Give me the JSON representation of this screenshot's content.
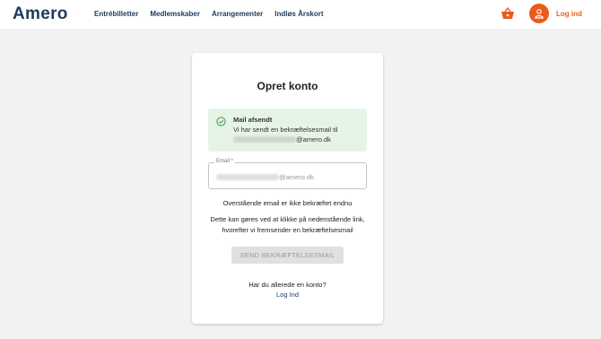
{
  "header": {
    "logo": "Amero",
    "nav": [
      "Entrébilletter",
      "Medlemskaber",
      "Arrangementer",
      "Indløs Årskort"
    ],
    "login_label": "Log ind",
    "basket_icon": "basket-icon",
    "user_icon": "user-icon"
  },
  "card": {
    "title": "Opret konto",
    "alert": {
      "title": "Mail afsendt",
      "text1": "Vi har sendt en bekræftelsesmail til",
      "email_suffix": "@amero.dk",
      "icon": "check-circle-icon"
    },
    "email_field": {
      "label": "Email *",
      "value_suffix": "@amero.dk"
    },
    "not_confirmed": "Overstående email er ikke bekræftet endnu",
    "instructions_line1": "Dette kan gøres ved at klikke på nedenstående link,",
    "instructions_line2": "hvorefter vi fremsender en bekræftelsesmail",
    "send_button": "SEND BEKRÆFTELSESMAIL",
    "have_account": "Har du allerede en konto?",
    "login_link": "Log Ind"
  },
  "colors": {
    "brand_dark": "#1f3a5f",
    "accent_orange": "#ea5b1c",
    "success_bg": "#e6f4e6",
    "success_icon": "#3a9a4a"
  }
}
